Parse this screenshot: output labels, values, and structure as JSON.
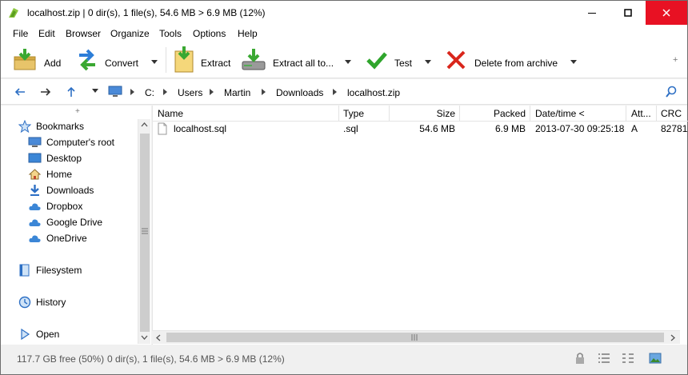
{
  "window": {
    "title": "localhost.zip | 0 dir(s), 1 file(s), 54.6 MB > 6.9 MB (12%)",
    "accent_close": "#e81123"
  },
  "menu": [
    "File",
    "Edit",
    "Browser",
    "Organize",
    "Tools",
    "Options",
    "Help"
  ],
  "toolbar": {
    "add": "Add",
    "convert": "Convert",
    "extract": "Extract",
    "extract_all": "Extract all to...",
    "test": "Test",
    "delete": "Delete from archive",
    "plus": "+"
  },
  "address": {
    "crumbs": [
      "C:",
      "Users",
      "Martin",
      "Downloads",
      "localhost.zip"
    ]
  },
  "sidebar": {
    "plus": "+",
    "bookmarks": "Bookmarks",
    "items": [
      "Computer's root",
      "Desktop",
      "Home",
      "Downloads",
      "Dropbox",
      "Google Drive",
      "OneDrive"
    ],
    "filesystem": "Filesystem",
    "history": "History",
    "open": "Open"
  },
  "columns": [
    "Name",
    "Type",
    "Size",
    "Packed",
    "Date/time <",
    "Att...",
    "CRC"
  ],
  "files": [
    {
      "name": "localhost.sql",
      "type": ".sql",
      "size": "54.6 MB",
      "packed": "6.9 MB",
      "date": "2013-07-30 09:25:18",
      "attr": "A",
      "crc": "82781"
    }
  ],
  "status": {
    "free": "117.7 GB free (50%)",
    "summary": "0 dir(s), 1 file(s), 54.6 MB > 6.9 MB (12%)"
  }
}
